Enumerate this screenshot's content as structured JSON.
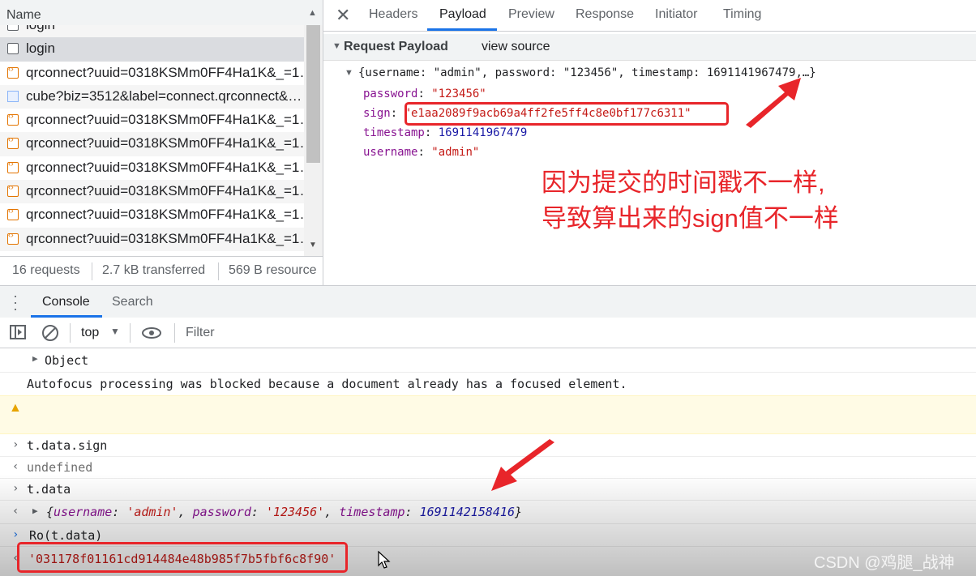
{
  "network": {
    "header": {
      "name_label": "Name"
    },
    "requests": [
      {
        "name": "login",
        "type": "doc"
      },
      {
        "name": "login",
        "type": "doc"
      },
      {
        "name": "qrconnect?uuid=0318KSMm0FF4Ha1K&_=1…",
        "type": "xhr"
      },
      {
        "name": "cube?biz=3512&label=connect.qrconnect&…",
        "type": "img"
      },
      {
        "name": "qrconnect?uuid=0318KSMm0FF4Ha1K&_=1…",
        "type": "xhr"
      },
      {
        "name": "qrconnect?uuid=0318KSMm0FF4Ha1K&_=1…",
        "type": "xhr"
      },
      {
        "name": "qrconnect?uuid=0318KSMm0FF4Ha1K&_=1…",
        "type": "xhr"
      },
      {
        "name": "qrconnect?uuid=0318KSMm0FF4Ha1K&_=1…",
        "type": "xhr"
      },
      {
        "name": "qrconnect?uuid=0318KSMm0FF4Ha1K&_=1…",
        "type": "xhr"
      },
      {
        "name": "qrconnect?uuid=0318KSMm0FF4Ha1K&_=1…",
        "type": "xhr"
      }
    ],
    "status": {
      "requests": "16 requests",
      "transferred": "2.7 kB transferred",
      "resources": "569 B resource"
    }
  },
  "detail": {
    "tabs": [
      "Headers",
      "Payload",
      "Preview",
      "Response",
      "Initiator",
      "Timing"
    ],
    "active_tab": "Payload",
    "payload": {
      "section_title": "Request Payload",
      "view_source": "view source",
      "summary": "{username: \"admin\", password: \"123456\", timestamp: 1691141967479,…}",
      "fields": [
        {
          "key": "password",
          "value": "\"123456\"",
          "kind": "str"
        },
        {
          "key": "sign",
          "value": "\"e1aa2089f9acb69a4ff2fe5ff4c8e0bf177c6311\"",
          "kind": "str"
        },
        {
          "key": "timestamp",
          "value": "1691141967479",
          "kind": "num"
        },
        {
          "key": "username",
          "value": "\"admin\"",
          "kind": "str"
        }
      ]
    },
    "annotation": {
      "line1": "因为提交的时间戳不一样,",
      "line2": "导致算出来的sign值不一样"
    }
  },
  "drawer": {
    "tabs": [
      "Console",
      "Search"
    ],
    "active_tab": "Console",
    "toolbar": {
      "context": "top",
      "filter_placeholder": "Filter"
    },
    "lines": {
      "object": "Object",
      "autofocus": "Autofocus processing was blocked because a document already has a focused element.",
      "cmd1": "t.data.sign",
      "res1": "undefined",
      "cmd2": "t.data",
      "res2_open": "{",
      "res2_k1": "username",
      "res2_v1": "'admin'",
      "res2_k2": "password",
      "res2_v2": "'123456'",
      "res2_k3": "timestamp",
      "res2_v3": "1691142158416",
      "res2_close": "}",
      "cmd3": "Ro(t.data)",
      "res3": "'031178f01161cd914484e48b985f7b5fbf6c8f90'"
    }
  },
  "watermark": "CSDN @鸡腿_战神",
  "colors": {
    "accent": "#1a73e8",
    "annotation_red": "#e8252a"
  }
}
